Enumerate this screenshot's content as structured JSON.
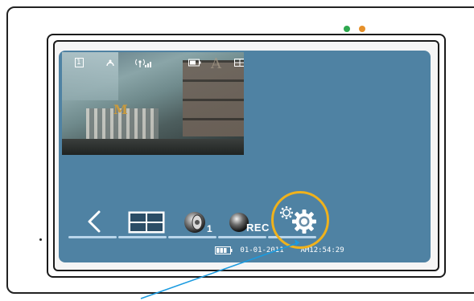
{
  "device": {
    "leds": [
      {
        "name": "power-led",
        "color": "#2fa84f"
      },
      {
        "name": "status-led",
        "color": "#e6902a"
      }
    ]
  },
  "screen": {
    "background_color": "#4f82a3",
    "camera_view": {
      "status_icons": [
        {
          "name": "camera-number-icon",
          "label": "1"
        },
        {
          "name": "night-mode-icon"
        },
        {
          "name": "signal-strength-icon"
        },
        {
          "name": "battery-icon"
        },
        {
          "name": "split-view-icon"
        }
      ]
    },
    "toolbar": {
      "back": {
        "icon": "chevron-left-icon"
      },
      "split": {
        "icon": "split-screen-icon"
      },
      "speaker": {
        "icon": "speaker-icon",
        "label": "1"
      },
      "record": {
        "icon": "record-icon",
        "label": "REC"
      },
      "settings": {
        "icon": "gear-icon",
        "highlighted": true,
        "highlight_color": "#f0b21c"
      }
    },
    "status_bar": {
      "battery_icon": "battery-icon",
      "date": "01-01-2011",
      "time": "AM12:54:29"
    }
  },
  "annotation": {
    "pointer_color": "#1a9be0"
  }
}
